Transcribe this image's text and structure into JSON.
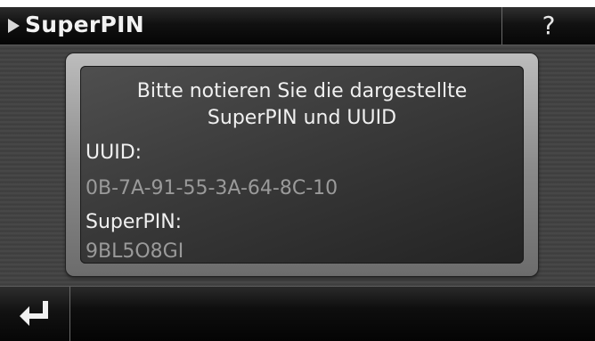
{
  "header": {
    "title": "SuperPIN",
    "help_label": "?"
  },
  "dialog": {
    "message": "Bitte notieren Sie die dargestellte\nSuperPIN und UUID",
    "uuid_label": "UUID:",
    "uuid_value": "0B-7A-91-55-3A-64-8C-10",
    "superpin_label": "SuperPIN:",
    "superpin_value": "9BL5O8GI"
  },
  "footer": {
    "back_icon": "return-arrow-icon"
  },
  "colors": {
    "text": "#f0f0f0",
    "value_text": "#9a9a9a",
    "bar_background": "#0b0b0b"
  }
}
